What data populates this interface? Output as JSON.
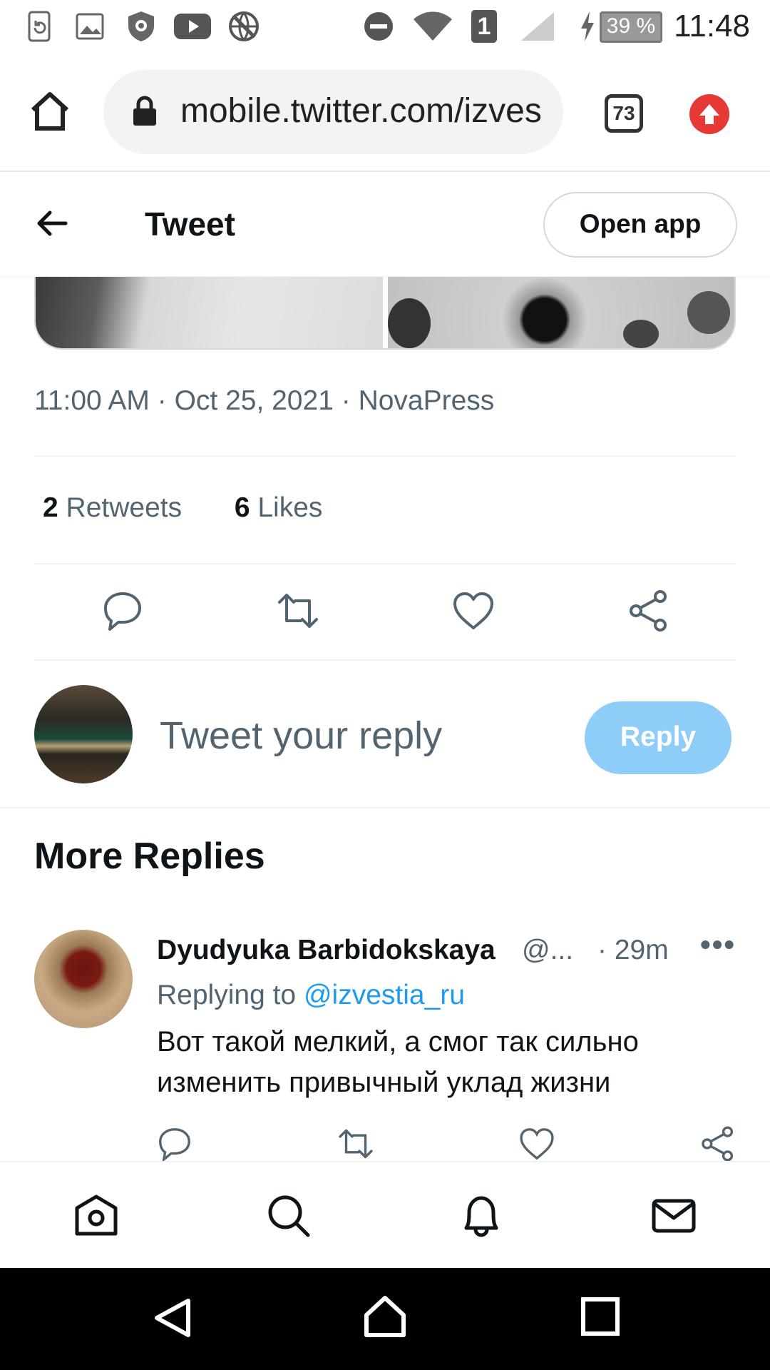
{
  "status_bar": {
    "battery": "39 %",
    "sim_slot": "1",
    "time": "11:48"
  },
  "browser": {
    "url": "mobile.twitter.com/izves",
    "tab_count": "73"
  },
  "header": {
    "title": "Tweet",
    "open_app_label": "Open app"
  },
  "tweet": {
    "time": "11:00 AM",
    "date": "Oct 25, 2021",
    "source": "NovaPress",
    "retweets_count": "2",
    "retweets_label": "Retweets",
    "likes_count": "6",
    "likes_label": "Likes"
  },
  "composer": {
    "placeholder": "Tweet your reply",
    "reply_label": "Reply"
  },
  "more_replies": {
    "title": "More Replies",
    "items": [
      {
        "name": "Dyudyuka Barbidokskaya",
        "handle": "@...",
        "time": "· 29m",
        "replying_prefix": "Replying to",
        "replying_handle": "@izvestia_ru",
        "text": "Вот такой мелкий, а смог так сильно изменить привычный уклад жизни"
      }
    ]
  },
  "colors": {
    "link": "#1d9bf0",
    "secondary_text": "#536471",
    "reply_button": "#8ecdf8"
  },
  "icons": {
    "status_bar": [
      "sync-icon",
      "image-icon",
      "shield-icon",
      "youtube-icon",
      "vpn-icon",
      "dnd-icon",
      "wifi-icon",
      "signal-icon",
      "charging-icon"
    ],
    "browser": [
      "home-icon",
      "lock-icon",
      "tabs-icon",
      "update-icon"
    ],
    "tweet_actions": [
      "reply-icon",
      "retweet-icon",
      "like-icon",
      "share-icon"
    ],
    "bottom_nav": [
      "home-icon",
      "search-icon",
      "notifications-icon",
      "messages-icon"
    ],
    "system_nav": [
      "back-icon",
      "home-icon",
      "recents-icon"
    ]
  }
}
